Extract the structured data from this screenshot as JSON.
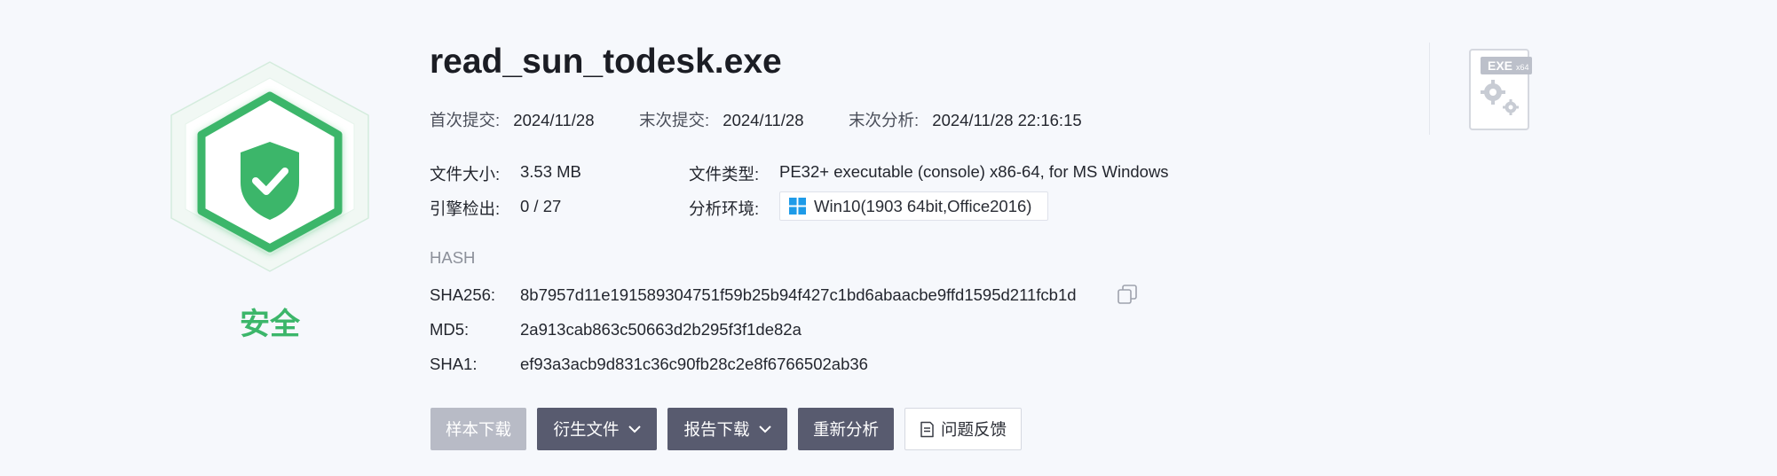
{
  "verdict": {
    "label": "安全",
    "color": "#3cb66a",
    "icon": "shield-check-icon"
  },
  "file": {
    "name": "read_sun_todesk.exe",
    "first_submit_label": "首次提交:",
    "first_submit_value": "2024/11/28",
    "last_submit_label": "末次提交:",
    "last_submit_value": "2024/11/28",
    "last_analysis_label": "末次分析:",
    "last_analysis_value": "2024/11/28 22:16:15",
    "size_label": "文件大小:",
    "size_value": "3.53 MB",
    "type_label": "文件类型:",
    "type_value": "PE32+ executable (console) x86-64, for MS Windows",
    "engines_label": "引擎检出:",
    "engines_value": "0 / 27",
    "env_label": "分析环境:",
    "env_value": "Win10(1903 64bit,Office2016)",
    "env_icon": "windows-logo-icon"
  },
  "hash": {
    "title": "HASH",
    "sha256_label": "SHA256:",
    "sha256_value": "8b7957d11e191589304751f59b25b94f427c1bd6abaacbe9ffd1595d211fcb1d",
    "md5_label": "MD5:",
    "md5_value": "2a913cab863c50663d2b295f3f1de82a",
    "sha1_label": "SHA1:",
    "sha1_value": "ef93a3acb9d831c36c90fb28c2e8f6766502ab36",
    "copy_icon": "copy-icon"
  },
  "buttons": {
    "sample_download": "样本下载",
    "derived_files": "衍生文件",
    "report_download": "报告下载",
    "reanalyze": "重新分析",
    "feedback": "问题反馈"
  },
  "filetype_badge": {
    "label": "EXE",
    "sub": "x64",
    "icon": "gears-icon"
  },
  "colors": {
    "accent_green": "#3cb66a",
    "button_dark": "#585b6f",
    "button_disabled": "#b8bbc6"
  }
}
